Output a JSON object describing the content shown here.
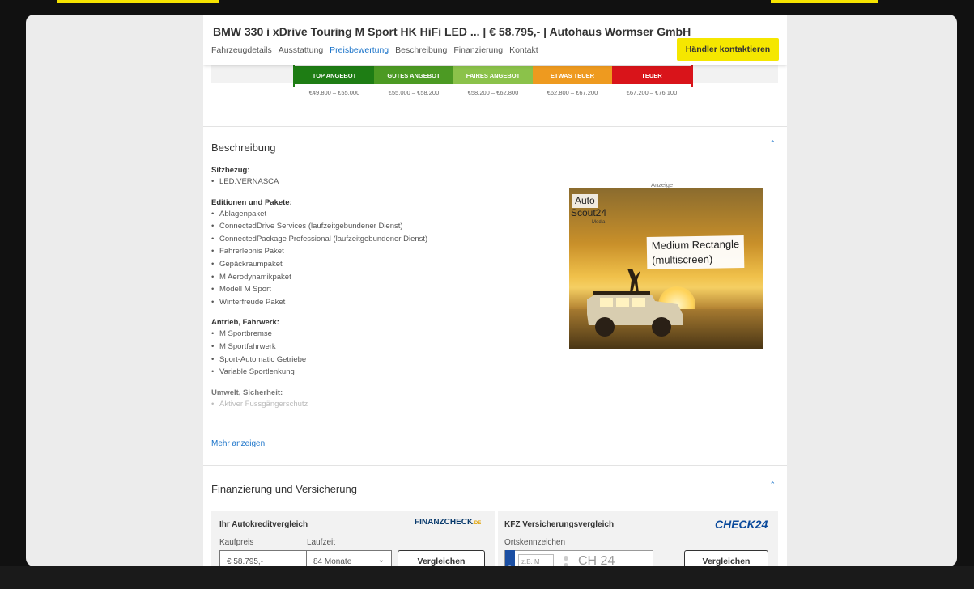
{
  "header": {
    "title": "BMW 330 i xDrive Touring M Sport HK HiFi LED ...  | € 58.795,- | Autohaus Wormser GmbH",
    "nav": [
      "Fahrzeugdetails",
      "Ausstattung",
      "Preisbewertung",
      "Beschreibung",
      "Finanzierung",
      "Kontakt"
    ],
    "active_nav": "Preisbewertung",
    "contact_button": "Händler kontaktieren"
  },
  "price_rating": {
    "segments": [
      {
        "label": "TOP ANGEBOT",
        "range": "€49.800 – €55.000",
        "color": "#1e7d14"
      },
      {
        "label": "GUTES ANGEBOT",
        "range": "€55.000 – €58.200",
        "color": "#4c9a23"
      },
      {
        "label": "FAIRES ANGEBOT",
        "range": "€58.200 – €62.800",
        "color": "#8bc24a"
      },
      {
        "label": "ETWAS TEUER",
        "range": "€62.800 – €67.200",
        "color": "#ee9a1f"
      },
      {
        "label": "TEUER",
        "range": "€67.200 – €76.100",
        "color": "#d9141a"
      }
    ]
  },
  "beschreibung": {
    "title": "Beschreibung",
    "collapse_icon": "chevron-up-icon",
    "groups": [
      {
        "heading": "Sitzbezug:",
        "items": [
          "LED.VERNASCA"
        ]
      },
      {
        "heading": "Editionen und Pakete:",
        "items": [
          "Ablagenpaket",
          "ConnectedDrive Services (laufzeitgebundener Dienst)",
          "ConnectedPackage Professional (laufzeitgebundener Dienst)",
          "Fahrerlebnis Paket",
          "Gepäckraumpaket",
          "M Aerodynamikpaket",
          "Modell M Sport",
          "Winterfreude Paket"
        ]
      },
      {
        "heading": "Antrieb, Fahrwerk:",
        "items": [
          "M Sportbremse",
          "M Sportfahrwerk",
          "Sport-Automatic Getriebe",
          "Variable Sportlenkung"
        ]
      },
      {
        "heading": "Umwelt, Sicherheit:",
        "items": [
          "Aktiver Fussgängerschutz"
        ]
      }
    ],
    "more_link": "Mehr anzeigen"
  },
  "ad": {
    "label": "Anzeige",
    "logo_line1": "Auto",
    "logo_line2": "Scout24",
    "logo_sub": "Media",
    "text_line1": "Medium Rectangle",
    "text_line2": "(multiscreen)"
  },
  "finanzierung": {
    "title": "Finanzierung und Versicherung",
    "credit": {
      "heading": "Ihr Autokreditvergleich",
      "brand": "FINANZCHECK",
      "brand_suffix": ".DE",
      "price_label": "Kaufpreis",
      "price_value": "€ 58.795,-",
      "term_label": "Laufzeit",
      "term_value": "84 Monate",
      "button": "Vergleichen"
    },
    "insurance": {
      "heading": "KFZ Versicherungsvergleich",
      "brand": "CHECK24",
      "plate_label": "Ortskennzeichen",
      "plate_placeholder": "z.B. M",
      "plate_eu": "D",
      "plate_text": "CH 24",
      "button": "Vergleichen"
    }
  },
  "colors": {
    "accent_yellow": "#f5e700",
    "link_blue": "#1a73c9"
  }
}
